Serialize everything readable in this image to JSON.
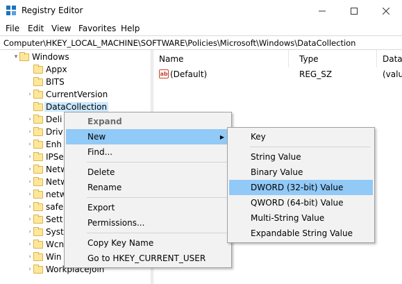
{
  "window": {
    "title": "Registry Editor",
    "minimize_glyph": "—",
    "maximize_glyph": "☐",
    "close_glyph": "✕"
  },
  "menu": [
    "File",
    "Edit",
    "View",
    "Favorites",
    "Help"
  ],
  "address": "Computer\\HKEY_LOCAL_MACHINE\\SOFTWARE\\Policies\\Microsoft\\Windows\\DataCollection",
  "tree": {
    "parent": "Windows",
    "children": [
      "Appx",
      "BITS",
      "CurrentVersion",
      "DataCollection",
      "Deli",
      "Driv",
      "Enh",
      "IPSe",
      "Netw",
      "Netw",
      "netw",
      "safe",
      "Sett",
      "Syst",
      "Wcn",
      "Win",
      "Workplacejoin"
    ]
  },
  "list": {
    "columns": [
      "Name",
      "Type",
      "Data"
    ],
    "rows": [
      {
        "name": "(Default)",
        "type": "REG_SZ",
        "data": "(valu",
        "icon": "ab-icon",
        "icon_text": "ab"
      }
    ]
  },
  "context_menu": {
    "items": [
      "Expand",
      "New",
      "Find...",
      "Delete",
      "Rename",
      "Export",
      "Permissions...",
      "Copy Key Name",
      "Go to HKEY_CURRENT_USER"
    ],
    "arrow_glyph": "▶"
  },
  "new_submenu": {
    "items": [
      "Key",
      "String Value",
      "Binary Value",
      "DWORD (32-bit) Value",
      "QWORD (64-bit) Value",
      "Multi-String Value",
      "Expandable String Value"
    ],
    "highlighted": "DWORD (32-bit) Value"
  },
  "colors": {
    "highlight": "#91c9f7",
    "tree_selected": "#cce8ff",
    "folder": "#ffe79a"
  }
}
